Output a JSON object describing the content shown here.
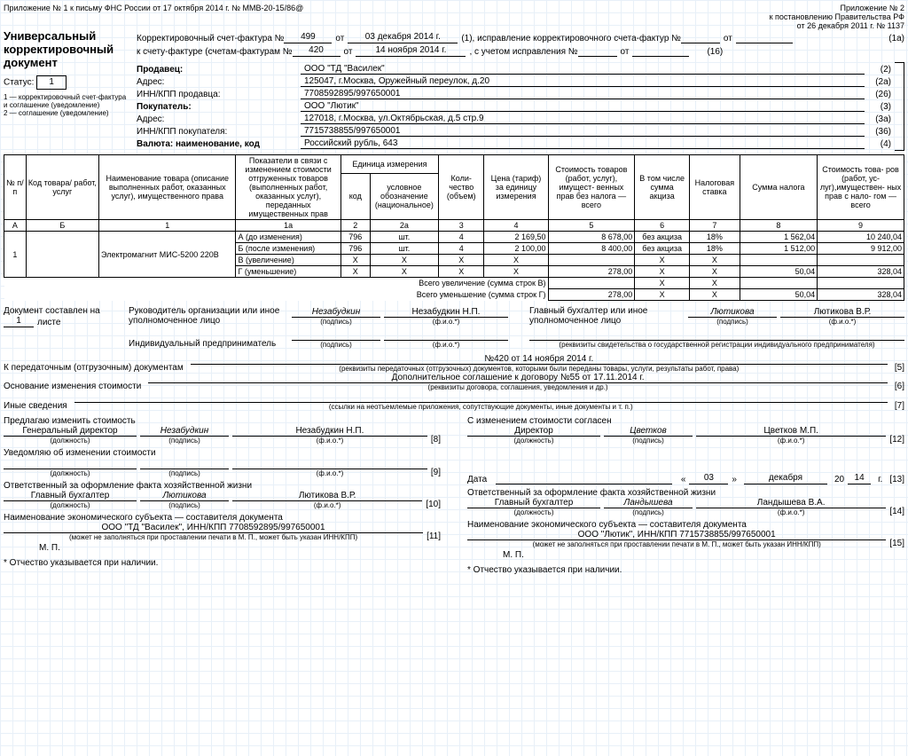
{
  "top_left": "Приложение № 1 к письму ФНС России от 17 октября 2014 г. № ММВ-20-15/86@",
  "top_right1": "Приложение № 2",
  "top_right2": "к постановлению Правительства РФ",
  "top_right3": "от 26 декабря 2011 г. № 1137",
  "title1": "Универсальный",
  "title2": "корректировочный",
  "title3": "документ",
  "l_ksf": "Корректировочный счет-фактура №",
  "ksf_no": "499",
  "ot": "от",
  "ksf_date": "03 декабря 2014 г.",
  "ksf_tail": "(1), исправление корректировочного счета-фактур №",
  "tag_1a": "(1а)",
  "l_sf": "к счету-фактуре (счетам-фактурам №",
  "sf_no": "420",
  "sf_date": "14 ноября 2014 г.",
  "sf_tail": ", с учетом исправления №",
  "tag_16": "(16)",
  "status_lab": "Статус:",
  "status_val": "1",
  "status_note": "1 — корректировочный счет-фактура и соглашение (уведомление)\n2 — соглашение (уведомление)",
  "seller_lab": "Продавец:",
  "seller": "ООО \"ТД \"Василек\"",
  "c2": "(2)",
  "addr_lab": "Адрес:",
  "seller_addr": "125047, г.Москва, Оружейный переулок, д.20",
  "c2a": "(2а)",
  "innkpp_s_lab": "ИНН/КПП продавца:",
  "innkpp_s": "7708592895/997650001",
  "c26": "(26)",
  "buyer_lab": "Покупатель:",
  "buyer": "ООО \"Лютик\"",
  "c3": "(3)",
  "buyer_addr": "127018, г.Москва, ул.Октябрьская, д.5 стр.9",
  "c3a": "(3а)",
  "innkpp_b_lab": "ИНН/КПП покупателя:",
  "innkpp_b": "7715738855/997650001",
  "c36": "(36)",
  "cur_lab": "Валюта: наименование, код",
  "cur": "Российский рубль, 643",
  "c4": "(4)",
  "th": {
    "np": "№ п/п",
    "code": "Код товара/ работ, услуг",
    "name": "Наименование товара (описание выполненных работ, оказанных услуг), имущественного права",
    "ind": "Показатели в связи с изменением стоимости отгруженных товаров (выполненных работ, оказанных услуг), переданных имущественных прав",
    "unit": "Единица измерения",
    "unit_code": "код",
    "unit_name": "условное обозначение (национальное)",
    "qty": "Коли- чество (объем)",
    "price": "Цена (тариф) за единицу измерения",
    "cost": "Стоимость товаров (работ, услуг), имущест- венных прав без налога — всего",
    "excise": "В том числе сумма акциза",
    "rate": "Налоговая ставка",
    "tax": "Сумма налога",
    "total": "Стоимость това- ров (работ, ус- луг),имуществен- ных прав с нало- гом — всего"
  },
  "sub": {
    "A": "А",
    "B": "Б",
    "1": "1",
    "1a": "1а",
    "2": "2",
    "2a": "2а",
    "3": "3",
    "4": "4",
    "5": "5",
    "6": "6",
    "7": "7",
    "8": "8",
    "9": "9"
  },
  "item": {
    "n": "1",
    "name": "Электромагнит МИС-5200 220В",
    "rows": [
      {
        "lab": "А (до изменения)",
        "code": "796",
        "unit": "шт.",
        "qty": "4",
        "price": "2 169,50",
        "cost": "8 678,00",
        "exc": "без акциза",
        "rate": "18%",
        "tax": "1 562,04",
        "tot": "10 240,04"
      },
      {
        "lab": "Б (после изменения)",
        "code": "796",
        "unit": "шт.",
        "qty": "4",
        "price": "2 100,00",
        "cost": "8 400,00",
        "exc": "без акциза",
        "rate": "18%",
        "tax": "1 512,00",
        "tot": "9 912,00"
      },
      {
        "lab": "В (увеличение)",
        "code": "Х",
        "unit": "Х",
        "qty": "Х",
        "price": "Х",
        "cost": "",
        "exc": "Х",
        "rate": "Х",
        "tax": "",
        "tot": ""
      },
      {
        "lab": "Г (уменьшение)",
        "code": "Х",
        "unit": "Х",
        "qty": "Х",
        "price": "Х",
        "cost": "278,00",
        "exc": "Х",
        "rate": "Х",
        "tax": "50,04",
        "tot": "328,04"
      }
    ]
  },
  "sum_inc_lab": "Всего увеличение (сумма строк В)",
  "sum_inc": {
    "cost": "",
    "exc": "Х",
    "rate": "Х",
    "tax": "",
    "tot": ""
  },
  "sum_dec_lab": "Всего уменьшение (сумма строк Г)",
  "sum_dec": {
    "cost": "278,00",
    "exc": "Х",
    "rate": "Х",
    "tax": "50,04",
    "tot": "328,04"
  },
  "doc_on_sheet_lab": "Документ составлен на",
  "doc_on_sheet_val": "1",
  "doc_on_sheet_suffix": "листе",
  "head_org": "Руководитель организации или иное уполномоченное лицо",
  "head_sign": "Незабудкин",
  "head_fio": "Незабудкин Н.П.",
  "chief_acc": "Главный бухгалтер или иное уполномоченное лицо",
  "chief_sign": "Лютикова",
  "chief_fio": "Лютикова В.Р.",
  "ip_lab": "Индивидуальный предприниматель",
  "ip_hint": "(реквизиты свидетельства о государственной регистрации индивидуального предпринимателя)",
  "sub_sign": "(подпись)",
  "sub_fio": "(ф.и.о.*)",
  "line5_lab": "К передаточным (отгрузочным) документам",
  "line5_val": "№420 от 14 ноября 2014 г.",
  "line5_hint": "(реквизиты передаточных (отгрузочных) документов, которыми были переданы товары, услуги, результаты работ, права)",
  "tag5": "[5]",
  "line6_lab": "Основание изменения стоимости",
  "line6_val": "Дополнительное соглашение к договору №55 от 17.11.2014 г.",
  "line6_hint": "(реквизиты договора, соглашения, уведомления и др.)",
  "tag6": "[6]",
  "line7_lab": "Иные сведения",
  "line7_hint": "(ссылки на неотъемлемые приложения, сопутствующие документы, иные документы и т. п.)",
  "tag7": "[7]",
  "left": {
    "propose": "Предлагаю изменить стоимость",
    "pos": "Генеральный директор",
    "sign": "Незабудкин",
    "fio": "Незабудкин Н.П.",
    "tag": "[8]",
    "notify": "Уведомляю об изменении стоимости",
    "tag9": "[9]",
    "resp": "Ответственный за оформление факта хозяйственной жизни",
    "pos2": "Главный бухгалтер",
    "sign2": "Лютикова",
    "fio2": "Лютикова В.Р.",
    "tag10": "[10]",
    "subj_lab": "Наименование экономического субъекта — составителя документа",
    "subj": "ООО \"ТД \"Василек\", ИНН/КПП 7708592895/997650001",
    "tag11": "[11]",
    "mp": "М. П."
  },
  "right": {
    "agree": "С изменением стоимости согласен",
    "pos": "Директор",
    "sign": "Цветков",
    "fio": "Цветков М.П.",
    "tag": "[12]",
    "date_lab": "Дата",
    "dq": "«",
    "d": "03",
    "dq2": "»",
    "m": "декабря",
    "y_pref": "20",
    "y": "14",
    "y_suf": "г.",
    "tag13": "[13]",
    "resp": "Ответственный за оформление факта хозяйственной жизни",
    "pos2": "Главный бухгалтер",
    "sign2": "Ландышева",
    "fio2": "Ландышева В.А.",
    "tag14": "[14]",
    "subj_lab": "Наименование экономического субъекта — составителя документа",
    "subj": "ООО \"Лютик\", ИНН/КПП 7715738855/997650001",
    "tag15": "[15]",
    "mp": "М. П."
  },
  "pos_hint": "(должность)",
  "mp_hint": "(может не заполняться при проставлении печати в М. П., может быть указан ИНН/КПП)",
  "foot_star": "* Отчество указывается при наличии."
}
